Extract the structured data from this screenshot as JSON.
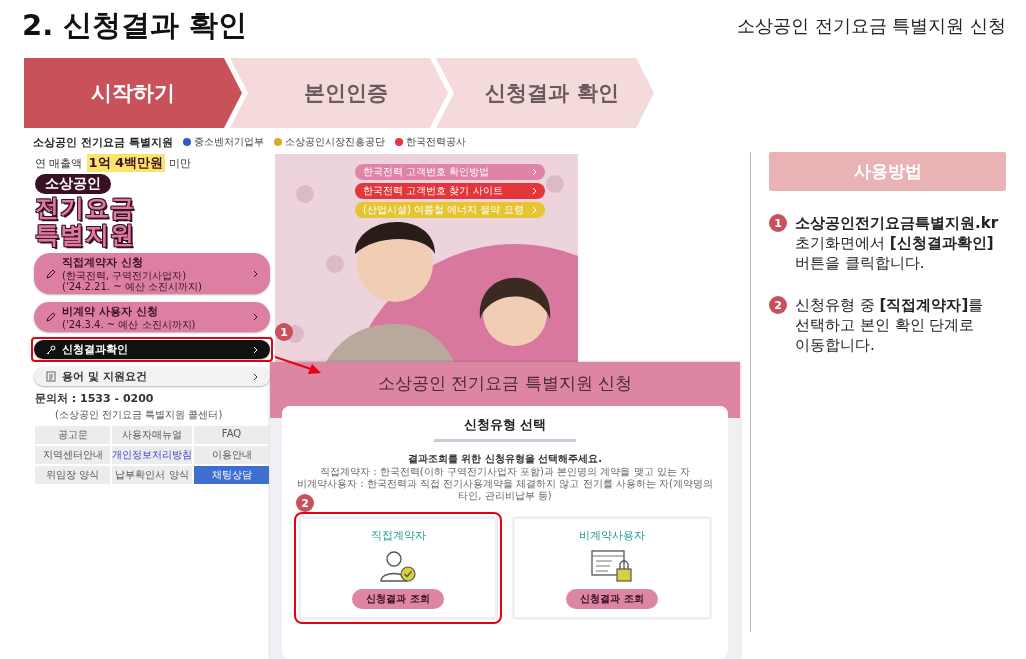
{
  "header": {
    "title": "2. 신청결과 확인",
    "subtitle": "소상공인 전기요금 특별지원 신청"
  },
  "steps": [
    {
      "label": "시작하기",
      "selected": true
    },
    {
      "label": "본인인증",
      "selected": false
    },
    {
      "label": "신청결과 확인",
      "selected": false
    }
  ],
  "site": {
    "brand": "소상공인 전기요금 특별지원",
    "agencies": [
      "중소벤처기업부",
      "소상공인시장진흥공단",
      "한국전력공사"
    ],
    "sales_prefix": "연 매출액",
    "sales_highlight": "1억 4백만원",
    "sales_suffix": "미만",
    "hero_tag": "소상공인",
    "hero_lines": [
      "전기요금",
      "특별지원"
    ],
    "menu": [
      {
        "kind": "pink",
        "label": "직접계약자 신청",
        "notes": [
          "(한국전력, 구역전기사업자)",
          "('24.2.21. ~ 예산 소진시까지)"
        ],
        "highlighted": false
      },
      {
        "kind": "pink",
        "label": "비계약 사용자 신청",
        "notes": [
          "('24.3.4. ~ 예산 소진시까지)"
        ],
        "highlighted": false
      },
      {
        "kind": "dark",
        "label": "신청결과확인",
        "highlighted": true,
        "badge": "1"
      },
      {
        "kind": "light",
        "label": "용어 및 지원요건",
        "highlighted": false
      }
    ],
    "contact": {
      "label": "문의처 : 1533 - 0200",
      "note": "(소상공인 전기요금 특별지원 콜센터)"
    },
    "links": [
      {
        "label": "공고문",
        "kind": "plain"
      },
      {
        "label": "사용자매뉴얼",
        "kind": "plain"
      },
      {
        "label": "FAQ",
        "kind": "plain"
      },
      {
        "label": "지역센터안내",
        "kind": "plain"
      },
      {
        "label": "개인정보처리방침",
        "kind": "privacy"
      },
      {
        "label": "이용안내",
        "kind": "plain"
      },
      {
        "label": "위임장 양식",
        "kind": "plain"
      },
      {
        "label": "납부확인서 양식",
        "kind": "plain"
      },
      {
        "label": "채팅상담",
        "kind": "chat"
      }
    ],
    "notices": [
      {
        "label": "한국전력 고객번호 확인방법",
        "color": "#e083a6"
      },
      {
        "label": "한국전력 고객번호 찾기 사이트",
        "color": "#e2363b"
      },
      {
        "label": "(산업시설) 여름철 에너지 절약 요령",
        "color": "#e6c532"
      }
    ]
  },
  "apply": {
    "banner": "소상공인 전기요금 특별지원 신청",
    "heading": "신청유형 선택",
    "lead": "결과조회를 위한 신청유형을 선택해주세요.",
    "notes": [
      "직접계약자 : 한국전력(이하 구역전기사업자 포함)과 본인명의 계약을 맺고 있는 자",
      "비계약사용자 : 한국전력과 직접 전기사용계약을 체결하지 않고 전기를 사용하는 자(계약명의타인, 관리비납부 등)"
    ],
    "badge": "2",
    "options": [
      {
        "kind": "person",
        "title": "직접계약자",
        "button": "신청결과 조회",
        "highlighted": true
      },
      {
        "kind": "lock",
        "title": "비계약사용자",
        "button": "신청결과 조회",
        "highlighted": false
      }
    ]
  },
  "guide": {
    "title": "사용방법",
    "items": [
      {
        "number": "1",
        "text": "**소상공인전기요금특별지원.kr** 초기화면에서 **[신청결과확인]** 버튼을 클릭합니다."
      },
      {
        "number": "2",
        "text": "신청유형 중 **[직접계약자]**를 선택하고 본인 확인 단계로 이동합니다."
      }
    ]
  }
}
